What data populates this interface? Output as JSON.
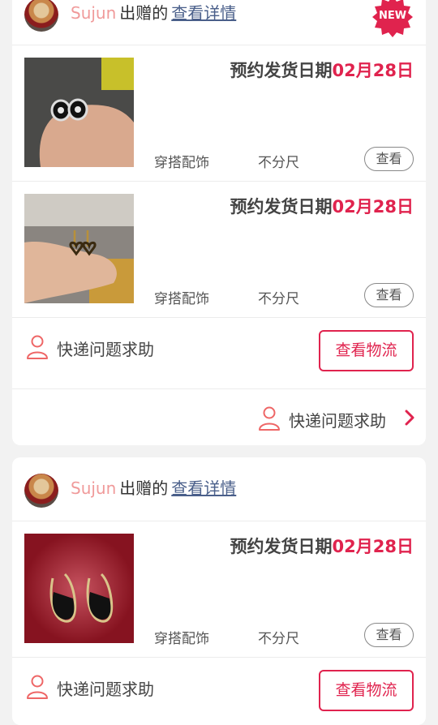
{
  "colors": {
    "accent": "#e0234e",
    "nickname": "#f09a9a",
    "link": "#4a5f8a",
    "background": "#f2f2f2"
  },
  "cards": [
    {
      "nickname": "Sujun",
      "gift_text": "出赠的",
      "detail_link": "查看详情",
      "badge": "NEW",
      "items": [
        {
          "ship_label": "预约发货日期",
          "ship_date": "02月28日",
          "category": "穿搭配饰",
          "size": "不分尺",
          "view_label": "查看"
        },
        {
          "ship_label": "预约发货日期",
          "ship_date": "02月28日",
          "category": "穿搭配饰",
          "size": "不分尺",
          "view_label": "查看"
        }
      ],
      "help_label": "快递问题求助",
      "logistics_label": "查看物流",
      "bottom_help_label": "快递问题求助"
    },
    {
      "nickname": "Sujun",
      "gift_text": "出赠的",
      "detail_link": "查看详情",
      "items": [
        {
          "ship_label": "预约发货日期",
          "ship_date": "02月28日",
          "category": "穿搭配饰",
          "size": "不分尺",
          "view_label": "查看"
        }
      ],
      "help_label": "快递问题求助",
      "logistics_label": "查看物流"
    }
  ],
  "icons": {
    "help": "user-outline-icon",
    "chevron": "chevron-right-icon",
    "avatar": "avatar"
  }
}
